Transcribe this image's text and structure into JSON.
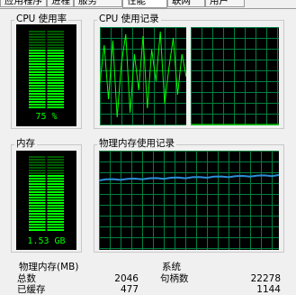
{
  "tabs": [
    {
      "label": "应用程序"
    },
    {
      "label": "进程"
    },
    {
      "label": "服务"
    },
    {
      "label": "性能"
    },
    {
      "label": "联网"
    },
    {
      "label": "用户"
    }
  ],
  "cpu_usage": {
    "label": "CPU 使用率",
    "value_text": "75 %",
    "level": 0.75
  },
  "cpu_history": {
    "label": "CPU 使用记录"
  },
  "memory": {
    "label": "内存",
    "value_text": "1.53 GB",
    "level": 0.75
  },
  "memory_history": {
    "label": "物理内存使用记录"
  },
  "physical_memory": {
    "label": "物理内存(MB)",
    "rows": [
      {
        "label": "总数",
        "value": "2046"
      },
      {
        "label": "已缓存",
        "value": "477"
      }
    ]
  },
  "system": {
    "label": "系统",
    "rows": [
      {
        "label": "句柄数",
        "value": "22278"
      },
      {
        "label": "",
        "value": "1144"
      }
    ]
  },
  "colors": {
    "graph_bg": "#000000",
    "grid": "#008040",
    "trace": "#00ff00",
    "memory_trace": "#2b8fd8"
  }
}
